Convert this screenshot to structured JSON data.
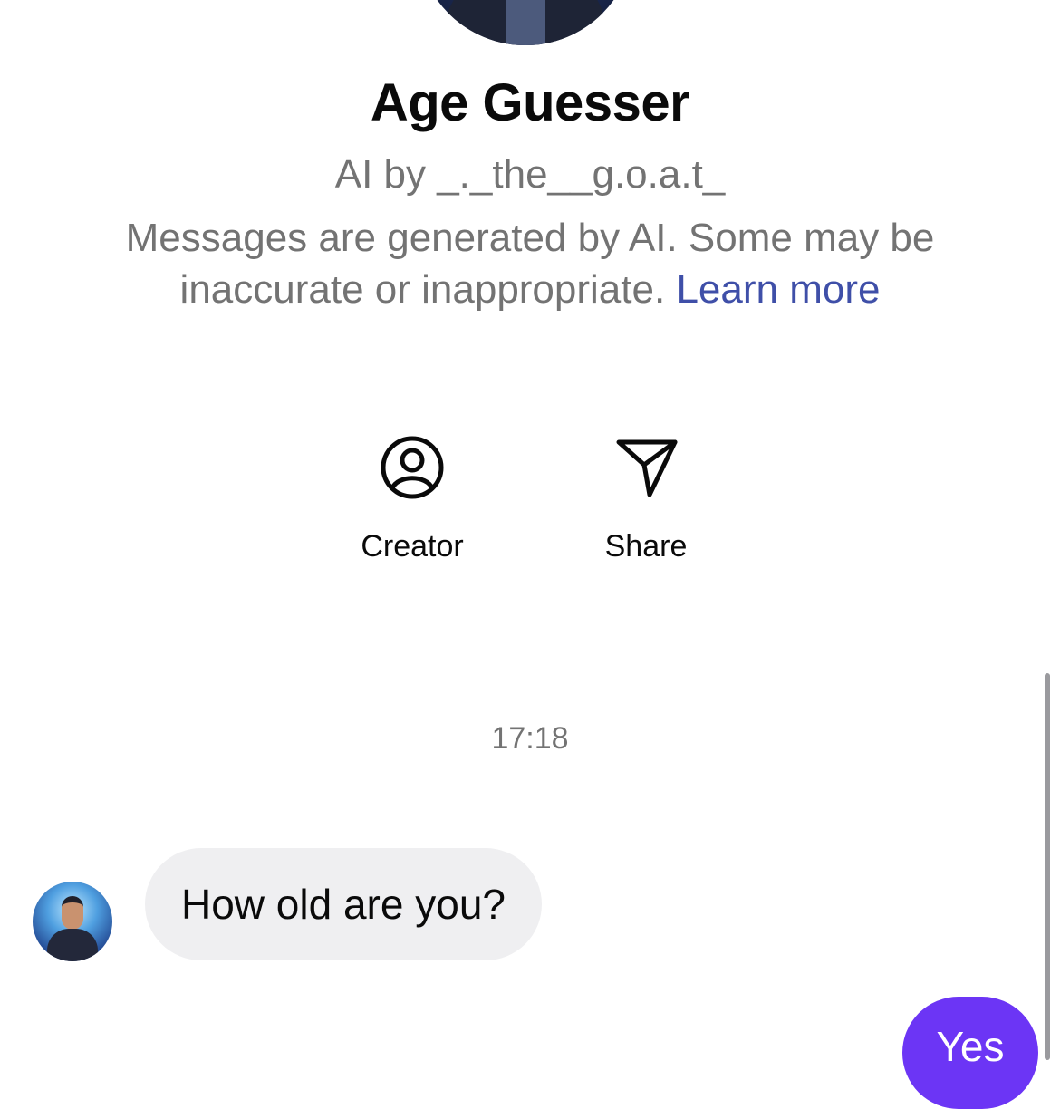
{
  "profile": {
    "title": "Age Guesser",
    "creator_line": "AI by _._the__g.o.a.t_",
    "disclaimer_text": "Messages are generated by AI. Some may be inaccurate or inappropriate.",
    "learn_more_label": "Learn more"
  },
  "actions": [
    {
      "label": "Creator",
      "icon": "user-circle-icon"
    },
    {
      "label": "Share",
      "icon": "paper-plane-icon"
    }
  ],
  "chat": {
    "timestamp": "17:18",
    "messages": [
      {
        "sender": "ai",
        "text": "How old are you?"
      },
      {
        "sender": "user",
        "text": "Yes"
      }
    ]
  },
  "colors": {
    "accent": "#6c35f5",
    "link": "#3f4fa8",
    "secondary_text": "#737373",
    "incoming_bubble": "#efeff1"
  }
}
